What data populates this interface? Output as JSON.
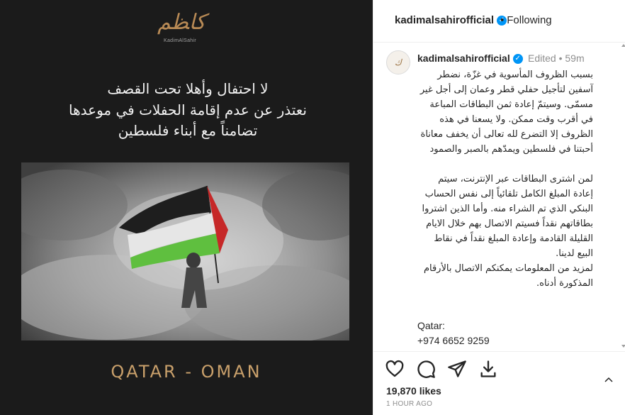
{
  "post": {
    "logo_text": "KadimAlSahir",
    "poster_line1": "لا احتفال وأهلا تحت القصف",
    "poster_line2": "نعتذر عن عدم إقامة الحفلات في موعدها",
    "poster_line3": "تضامناً مع أبناء فلسطين",
    "locations": "QATAR - OMAN"
  },
  "header": {
    "username": "kadimalsahirofficial",
    "follow_status": "Following"
  },
  "caption": {
    "username": "kadimalsahirofficial",
    "edited": "Edited",
    "time": "59m",
    "text": "بسبب الظروف المأسوية في غزّة، نضطر آسفين لتأجيل حفلي قطر وعمان إلى أجل غير مسمّى. وسيتمّ إعادة ثمن البطاقات المباعة في أقرب وقت ممكن. ولا يسعنا في هذه الظروف إلا التضرع لله تعالى أن يخفف معاناة أحبتنا في فلسطين ويمدّهم بالصبر والصمود\n\nلمن اشترى البطاقات عبر الإنترنت، سيتم إعادة المبلغ الكامل تلقائياً إلى نفس الحساب البنكي الذي تم الشراء منه. وأما الذين اشتروا بطاقاتهم نقداً فسيتم الاتصال بهم خلال الايام القليلة القادمة وإعادة المبلغ نقداً في نقاط البيع لدينا.\nلمزيد من المعلومات يمكنكم الاتصال بالأرقام المذكورة أدناه.",
    "contact_label": "Qatar:",
    "contact_phone": "+974 6652 9259"
  },
  "actions": {
    "icons": [
      "heart-icon",
      "comment-icon",
      "share-icon",
      "save-icon"
    ]
  },
  "stats": {
    "likes": "19,870 likes",
    "time_ago": "1 HOUR AGO"
  },
  "colors": {
    "accent_gold": "#c9a06b",
    "verified_blue": "#0095f6",
    "media_bg": "#1b1b1b"
  }
}
